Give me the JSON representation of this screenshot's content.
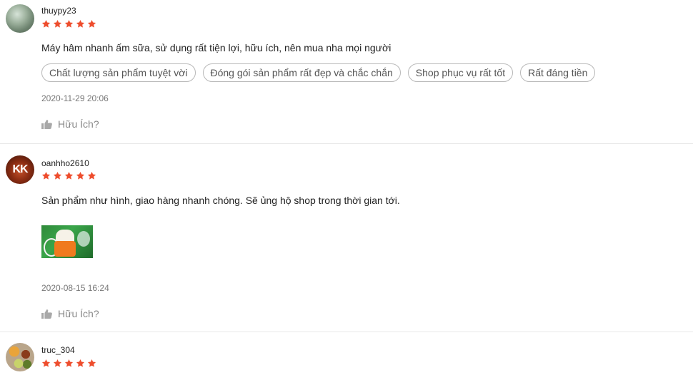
{
  "colors": {
    "star": "#ee4d2d",
    "tag_border": "#b8b8b8",
    "muted_text": "#777777"
  },
  "reviews": [
    {
      "username": "thuypy23",
      "rating": 5,
      "comment": "Máy hâm nhanh ấm sữa, sử dụng rất tiện lợi, hữu ích, nên mua nha mọi người",
      "tags": [
        "Chất lượng sản phẩm tuyệt vời",
        "Đóng gói sản phẩm rất đẹp và chắc chắn",
        "Shop phục vụ rất tốt",
        "Rất đáng tiền"
      ],
      "datetime": "2020-11-29 20:06",
      "helpful_label": "Hữu Ích?",
      "helpful_icon": "thumbs-up-icon"
    },
    {
      "username": "oanhho2610",
      "avatar_text": "KK",
      "rating": 5,
      "comment": "Sản phẩm như hình, giao hàng nhanh chóng. Sẽ ủng hộ shop trong thời gian tới.",
      "datetime": "2020-08-15 16:24",
      "helpful_label": "Hữu Ích?",
      "helpful_icon": "thumbs-up-icon"
    },
    {
      "username": "truc_304",
      "rating": 5
    }
  ]
}
